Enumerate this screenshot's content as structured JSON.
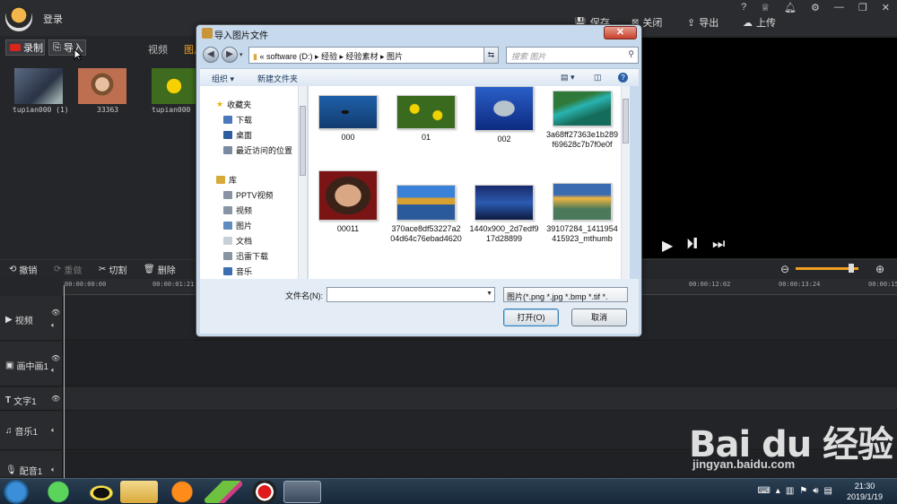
{
  "app": {
    "login": "登录",
    "toolbar": {
      "save": "保存",
      "close": "关闭",
      "export": "导出",
      "upload": "上传"
    },
    "top_icons": [
      "?",
      "VIP",
      "bell-icon",
      "gear-icon",
      "minimize-icon",
      "maximize-icon",
      "close-icon"
    ],
    "record_button": "录制",
    "import_button": "导入",
    "tabs": [
      "视频",
      "图片"
    ],
    "media": [
      {
        "label": "tupian000 (1)"
      },
      {
        "label": "33363"
      },
      {
        "label": "tupian000 ("
      }
    ],
    "edit_toolbar": {
      "undo": "撤销",
      "redo": "重做",
      "cut": "切割",
      "delete": "删除"
    },
    "ruler_ticks": [
      "00:00:00:00",
      "00:00:01:21",
      "00:00:12:02",
      "00:00:13:24",
      "00:00:15"
    ],
    "tracks": [
      {
        "label": "视频"
      },
      {
        "label": "画中画1"
      },
      {
        "label": "文字1"
      },
      {
        "label": "音乐1"
      },
      {
        "label": "配音1"
      }
    ]
  },
  "dialog": {
    "title": "导入图片文件",
    "address": "«  software (D:)  ▸  经验  ▸  经验素材  ▸  图片",
    "search_placeholder": "搜索 图片",
    "organize": "组织 ▾",
    "new_folder": "新建文件夹",
    "nav": {
      "favorites": "收藏夹",
      "downloads": "下载",
      "desktop": "桌面",
      "recent": "最近访问的位置",
      "library": "库",
      "pptv": "PPTV视频",
      "videos": "视频",
      "pictures": "图片",
      "documents": "文档",
      "xunlei": "迅雷下载",
      "music": "音乐"
    },
    "files": [
      {
        "name": "000"
      },
      {
        "name": "01"
      },
      {
        "name": "002"
      },
      {
        "name": "3a68ff27363e1b289f69628c7b7f0e0f"
      },
      {
        "name": "00011"
      },
      {
        "name": "370ace8df53227a204d64c76ebad4620"
      },
      {
        "name": "1440x900_2d7edf917d28899"
      },
      {
        "name": "39107284_1411954415923_mthumb"
      }
    ],
    "filename_label": "文件名(N):",
    "filename_value": "",
    "filetype": "图片(*.png *.jpg *.bmp *.tif *.",
    "open_button": "打开(O)",
    "cancel_button": "取消"
  },
  "taskbar": {
    "time": "21:30",
    "date": "2019/1/19"
  },
  "watermark": {
    "brand": "Bai du 经验",
    "url": "jingyan.baidu.com"
  }
}
